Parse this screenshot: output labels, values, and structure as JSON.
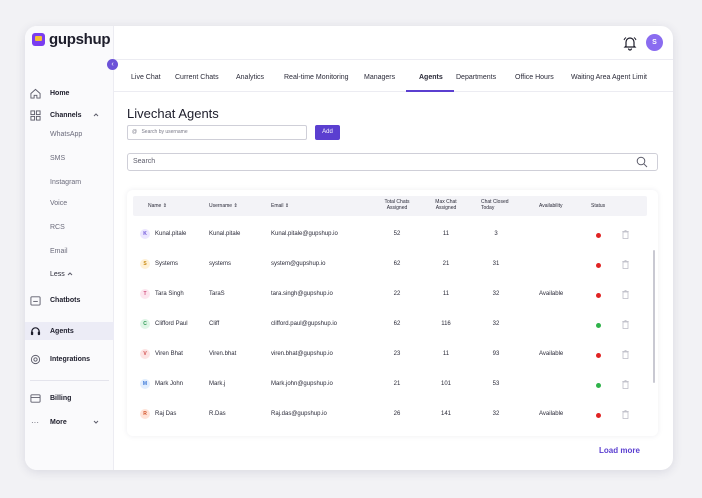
{
  "brand": {
    "name": "gupshup"
  },
  "user": {
    "initial": "S"
  },
  "sidebar": {
    "collapse_icon": "chevron-left-icon",
    "home": "Home",
    "channels": "Channels",
    "channel_items": [
      "WhatsApp",
      "SMS",
      "Instagram",
      "Voice",
      "RCS",
      "Email"
    ],
    "less": "Less",
    "chatbots": "Chatbots",
    "agents": "Agents",
    "integrations": "Integrations",
    "billing": "Billing",
    "more": "More"
  },
  "tabs": [
    "Live Chat",
    "Current Chats",
    "Analytics",
    "Real-time Monitoring",
    "Managers",
    "Agents",
    "Departments",
    "Office Hours",
    "Waiting Area Agent Limit"
  ],
  "active_tab": "Agents",
  "page": {
    "title": "Livechat Agents",
    "user_search_placeholder": "Search by username",
    "add_label": "Add",
    "search_placeholder": "Search",
    "load_more": "Load more"
  },
  "table": {
    "headers": {
      "name": "Name",
      "username": "Username",
      "email": "Email",
      "total_line1": "Total Chats",
      "total_line2": "Assigned",
      "max_line1": "Max Chat",
      "max_line2": "Assigned",
      "closed_line1": "Chat Closed",
      "closed_line2": "Today",
      "availability": "Availability",
      "status": "Status"
    },
    "rows": [
      {
        "initial": "K",
        "name": "Kunal.pitale",
        "username": "Kunal.pitale",
        "email": "Kunal.pitale@gupshup.io",
        "total": "52",
        "max": "11",
        "closed": "3",
        "availability": "",
        "status": "red",
        "av_bg": "#ece6ff",
        "av_fg": "#6c52d8"
      },
      {
        "initial": "S",
        "name": "Systems",
        "username": "systems",
        "email": "system@gupshup.io",
        "total": "62",
        "max": "21",
        "closed": "31",
        "availability": "",
        "status": "red",
        "av_bg": "#fff1d6",
        "av_fg": "#c98a12"
      },
      {
        "initial": "T",
        "name": "Tara Singh",
        "username": "TaraS",
        "email": "tara.singh@gupshup.io",
        "total": "22",
        "max": "11",
        "closed": "32",
        "availability": "Available",
        "status": "red",
        "av_bg": "#fde6ef",
        "av_fg": "#d0507e"
      },
      {
        "initial": "C",
        "name": "Clifford Paul",
        "username": "Cliff",
        "email": "clifford.paul@gupshup.io",
        "total": "62",
        "max": "116",
        "closed": "32",
        "availability": "",
        "status": "green",
        "av_bg": "#dff5e6",
        "av_fg": "#2f9a55"
      },
      {
        "initial": "V",
        "name": "Viren Bhat",
        "username": "Viren.bhat",
        "email": "viren.bhat@gupshup.io",
        "total": "23",
        "max": "11",
        "closed": "93",
        "availability": "Available",
        "status": "red",
        "av_bg": "#fde4e4",
        "av_fg": "#cf4a4a"
      },
      {
        "initial": "M",
        "name": "Mark John",
        "username": "Mark.j",
        "email": "Mark.john@gupshup.io",
        "total": "21",
        "max": "101",
        "closed": "53",
        "availability": "",
        "status": "green",
        "av_bg": "#e2eefe",
        "av_fg": "#3b78d8"
      },
      {
        "initial": "R",
        "name": "Raj Das",
        "username": "R.Das",
        "email": "Raj.das@gupshup.io",
        "total": "26",
        "max": "141",
        "closed": "32",
        "availability": "Available",
        "status": "red",
        "av_bg": "#ffe3d9",
        "av_fg": "#d2552b"
      }
    ]
  },
  "colors": {
    "accent": "#5b3fd0",
    "status_red": "#e02424",
    "status_green": "#2fb34a"
  }
}
